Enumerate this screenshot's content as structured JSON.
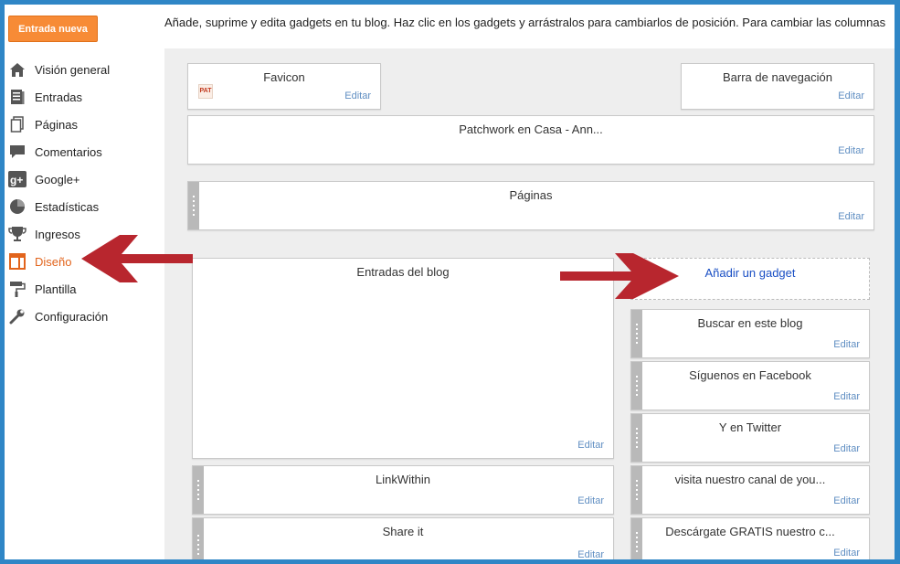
{
  "sidebar": {
    "new_post_label": "Entrada nueva",
    "items": [
      {
        "label": "Visión general",
        "icon": "home-icon"
      },
      {
        "label": "Entradas",
        "icon": "posts-icon"
      },
      {
        "label": "Páginas",
        "icon": "pages-icon"
      },
      {
        "label": "Comentarios",
        "icon": "comments-icon"
      },
      {
        "label": "Google+",
        "icon": "google-plus-icon"
      },
      {
        "label": "Estadísticas",
        "icon": "stats-icon"
      },
      {
        "label": "Ingresos",
        "icon": "trophy-icon"
      },
      {
        "label": "Diseño",
        "icon": "layout-icon",
        "active": true
      },
      {
        "label": "Plantilla",
        "icon": "paint-roller-icon"
      },
      {
        "label": "Configuración",
        "icon": "wrench-icon"
      }
    ]
  },
  "header": {
    "instructions": "Añade, suprime y edita gadgets en tu blog. Haz clic en los gadgets y arrástralos para cambiarlos de posición. Para cambiar las columnas"
  },
  "layout": {
    "edit_label": "Editar",
    "favicon_title": "Favicon",
    "favicon_image_text": "PAT",
    "navbar_title": "Barra de navegación",
    "header_title": "Patchwork en Casa - Ann...",
    "pages_title": "Páginas",
    "blog_posts_title": "Entradas del blog",
    "linkwithin_title": "LinkWithin",
    "shareit_title": "Share it",
    "add_gadget_label": "Añadir un gadget",
    "sidebar_gadgets": [
      "Buscar en este blog",
      "Síguenos en Facebook",
      "Y en Twitter",
      "visita nuestro canal de you...",
      "Descárgate GRATIS nuestro c..."
    ]
  },
  "colors": {
    "accent": "#f78b36",
    "active_nav": "#e2641c",
    "annotation_arrow": "#b8262e",
    "frame_border": "#2f86c6",
    "link": "#1a4fc4"
  }
}
